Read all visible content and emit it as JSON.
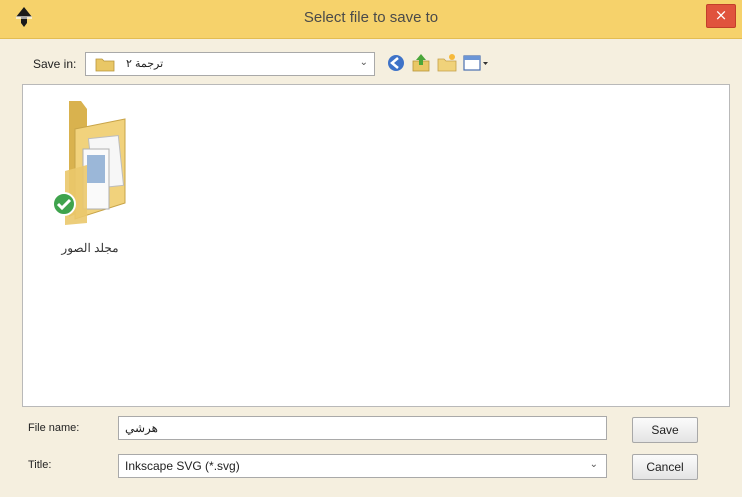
{
  "window": {
    "title": "Select file to save to",
    "close_glyph": "×"
  },
  "toolbar": {
    "save_in_label": "Save in:",
    "save_in_value": "ترجمة ٢",
    "dropdown_glyph": "⌄",
    "icons": [
      "back-icon",
      "up-folder-icon",
      "new-folder-icon",
      "view-menu-icon"
    ]
  },
  "files": [
    {
      "name": "مجلد الصور",
      "icon": "folder-icon",
      "badge": "green-check-icon"
    }
  ],
  "form": {
    "file_name_label": "File name:",
    "file_name_value": "هرشي",
    "type_label": "Title:",
    "type_value": "Inkscape SVG (*.svg)",
    "save_label": "Save",
    "cancel_label": "Cancel"
  },
  "colors": {
    "titlebar": "#f6d26b",
    "close": "#e0533d",
    "dialog_bg": "#f5efdf"
  }
}
